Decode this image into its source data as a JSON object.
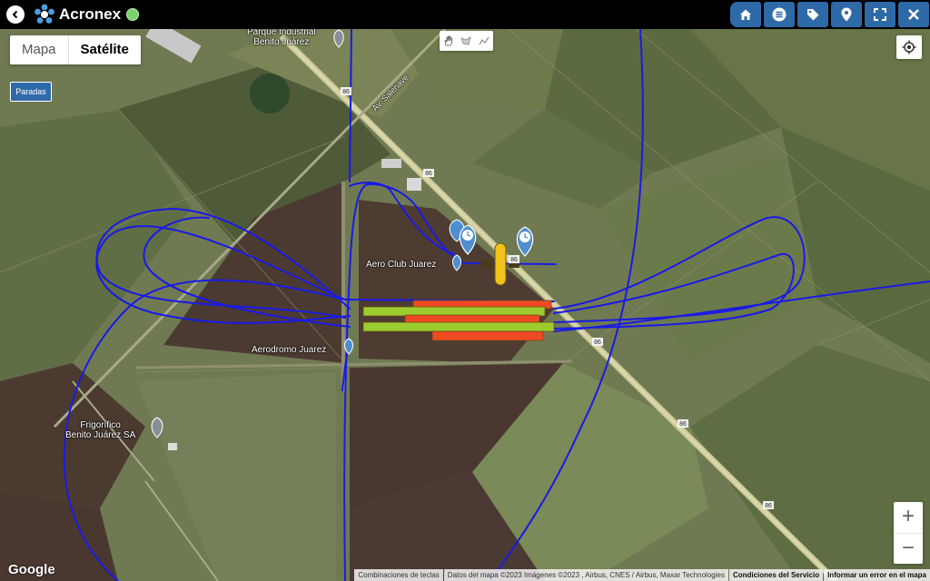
{
  "app": {
    "brand": "Acronex"
  },
  "map_type": {
    "map_label": "Mapa",
    "satellite_label": "Satélite",
    "selected": "Satélite"
  },
  "paradas_label": "Paradas",
  "places": [
    {
      "line1": "Parque Industrial",
      "line2": "Benito Juárez"
    },
    {
      "line1": "Aero Club Juarez",
      "line2": ""
    },
    {
      "line1": "Aerodromo Juarez",
      "line2": ""
    },
    {
      "line1": "Frigorífico",
      "line2": "Benito Juárez SA"
    }
  ],
  "roads": {
    "route_number": "86",
    "avenue": "Av. Salenave"
  },
  "zoom": {
    "in": "+",
    "out": "−"
  },
  "google_logo": "Google",
  "attribution": {
    "shortcuts": "Combinaciones de teclas",
    "map_data": "Datos del mapa ©2023 Imágenes ©2023 , Airbus, CNES / Airbus, Maxar Technologies",
    "terms": "Condiciones del Servicio",
    "report": "Informar un error en el mapa"
  },
  "colors": {
    "track": "#1a1ae6",
    "swath_green": "#9ccc2e",
    "swath_red": "#f04a24",
    "toolbar": "#2f6aa8",
    "aircraft": "#f2c21a"
  }
}
